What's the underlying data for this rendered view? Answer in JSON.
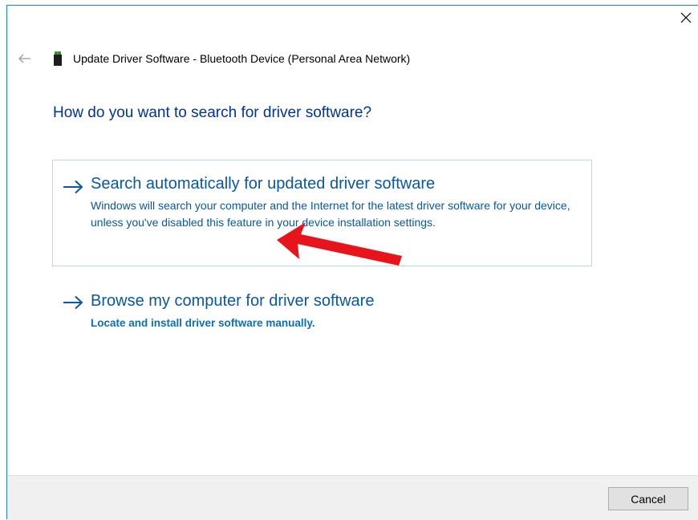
{
  "window": {
    "title": "Update Driver Software - Bluetooth Device (Personal Area Network)",
    "close_icon": "close-icon",
    "back_icon": "back-arrow-icon",
    "device_icon": "usb-device-icon"
  },
  "main": {
    "heading": "How do you want to search for driver software?",
    "options": [
      {
        "title": "Search automatically for updated driver software",
        "description": "Windows will search your computer and the Internet for the latest driver software for your device, unless you've disabled this feature in your device installation settings.",
        "icon": "arrow-right-icon"
      },
      {
        "title": "Browse my computer for driver software",
        "description": "Locate and install driver software manually.",
        "icon": "arrow-right-icon"
      }
    ]
  },
  "footer": {
    "cancel_label": "Cancel"
  },
  "colors": {
    "heading": "#003399",
    "link": "#0a57a5",
    "option_border": "#b9d7ee",
    "footer_bg": "#f0f0f0",
    "annotation": "#e8141b"
  }
}
